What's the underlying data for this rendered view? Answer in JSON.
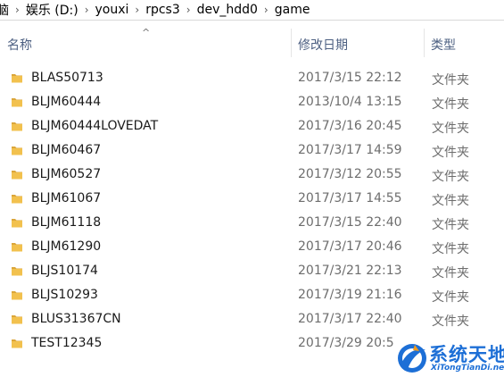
{
  "breadcrumb": {
    "parts": [
      "脑",
      "娱乐 (D:)",
      "youxi",
      "rpcs3",
      "dev_hdd0",
      "game"
    ],
    "separator": "›"
  },
  "columns": {
    "sort_indicator": "^",
    "name": "名称",
    "date": "修改日期",
    "type": "类型"
  },
  "rows": [
    {
      "name": "BLAS50713",
      "date": "2017/3/15 22:12",
      "type": "文件夹"
    },
    {
      "name": "BLJM60444",
      "date": "2013/10/4 13:15",
      "type": "文件夹"
    },
    {
      "name": "BLJM60444LOVEDAT",
      "date": "2017/3/16 20:45",
      "type": "文件夹"
    },
    {
      "name": "BLJM60467",
      "date": "2017/3/17 14:59",
      "type": "文件夹"
    },
    {
      "name": "BLJM60527",
      "date": "2017/3/12 20:55",
      "type": "文件夹"
    },
    {
      "name": "BLJM61067",
      "date": "2017/3/17 14:55",
      "type": "文件夹"
    },
    {
      "name": "BLJM61118",
      "date": "2017/3/15 22:40",
      "type": "文件夹"
    },
    {
      "name": "BLJM61290",
      "date": "2017/3/17 20:46",
      "type": "文件夹"
    },
    {
      "name": "BLJS10174",
      "date": "2017/3/21 22:13",
      "type": "文件夹"
    },
    {
      "name": "BLJS10293",
      "date": "2017/3/19 21:16",
      "type": "文件夹"
    },
    {
      "name": "BLUS31367CN",
      "date": "2017/3/17 22:40",
      "type": "文件夹"
    },
    {
      "name": "TEST12345",
      "date": "2017/3/29 20:5",
      "type": ""
    }
  ],
  "watermark": {
    "title": "系统天地",
    "url": "XiTongTianDi.net"
  },
  "colors": {
    "folder": "#f2c14e",
    "folder_dark": "#dba63a",
    "header_text": "#4d6082",
    "secondary_text": "#6d6d6d",
    "watermark_blue": "#1d6fd6"
  }
}
